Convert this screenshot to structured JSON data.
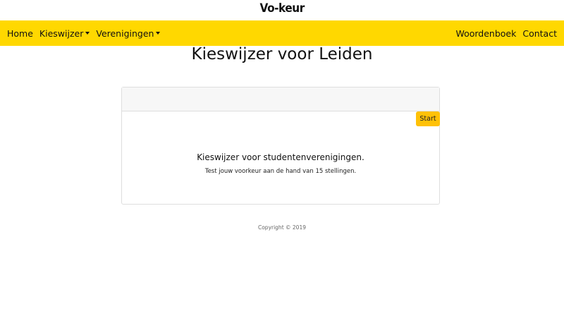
{
  "brand": {
    "logo_text": "Vo-keur"
  },
  "nav": {
    "home": "Home",
    "kieswijzer": "Kieswijzer",
    "verenigingen": "Verenigingen",
    "woordenboek": "Woordenboek",
    "contact": "Contact"
  },
  "main": {
    "title": "Kieswijzer voor Leiden",
    "card": {
      "start_label": "Start",
      "heading": "Kieswijzer voor studentenverenigingen.",
      "text": "Test jouw voorkeur aan de hand van 15 stellingen."
    }
  },
  "footer": {
    "copyright": "Copyright © 2019"
  },
  "colors": {
    "navbar": "#ffd800",
    "start_button": "#ffc107"
  }
}
